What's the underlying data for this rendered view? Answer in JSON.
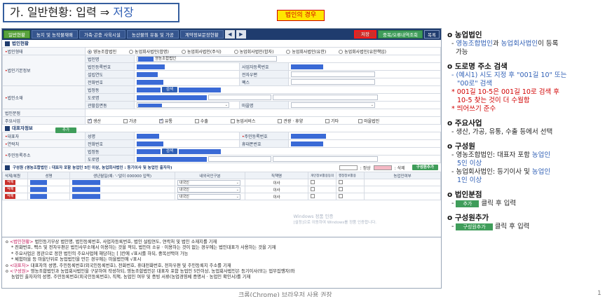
{
  "slide": {
    "title_prefix": "가. 일반현황: 입력 ⇒ ",
    "title_accent": "저장",
    "badge": "법인의 경우",
    "footer": "크롬(Chrome) 브라우저 사용 권장",
    "page_number": "1"
  },
  "tabs": [
    "일반현황",
    "농지 및 농작물재배",
    "가축·곤충 사육시설",
    "농산물의 유통 및 가공",
    "계약정보문장현황"
  ],
  "toolbar": {
    "save": "저장",
    "dup_check": "중복/오류내역조회",
    "list": "목록"
  },
  "section1": {
    "title": "법인현황",
    "corp_type_label": "법인형태",
    "corp_types": [
      "영농조합법인",
      "농업회사법인(합명)",
      "농업회사법인(주식)",
      "농업회사법인(합자)",
      "농업회사법인(유한)",
      "농업회사법인(유한책임)"
    ],
    "basic_info_label": "법인기본정보",
    "corp_name_label": "법인명",
    "corp_name_value": "영농조합법인",
    "corp_regno_label": "법인등록번호",
    "biz_regno_label": "사업자등록번호",
    "est_year_label": "설립연도",
    "email_label": "전자우편",
    "phone_label": "전화번호",
    "fax_label": "팩스",
    "location_label": "법인소재",
    "lot_label": "법정동",
    "search_btn": "검색",
    "road_label": "도로명",
    "admin_label": "관할읍면동",
    "village_label": "마을명",
    "branch_label": "법인분점",
    "add_btn": "추가",
    "main_biz_label": "주요사업",
    "main_biz": [
      {
        "label": "생산",
        "checked": true
      },
      {
        "label": "가공",
        "checked": false
      },
      {
        "label": "유통",
        "checked": true
      },
      {
        "label": "수출",
        "checked": false
      },
      {
        "label": "농업서비스",
        "checked": false
      },
      {
        "label": "관광 · 휴양",
        "checked": false
      },
      {
        "label": "기타",
        "checked": false
      },
      {
        "label": "마을법인",
        "checked": false
      }
    ]
  },
  "section2": {
    "title": "대표자정보",
    "rep_label": "대표자",
    "name_label": "성명",
    "rrn_label": "주민등록번호",
    "contact_label": "연락처",
    "phone_label": "전화번호",
    "mobile_label": "휴대폰번호",
    "address_label": "주민등록주소",
    "lot_label": "법정동",
    "search_btn": "검색",
    "road_label": "도로명"
  },
  "members": {
    "title": "구성원 (영농조합법인 : 대표자 포함 농업인 5인 이상, 농업회사법인 : 등기이사 및 농업인 출자자)",
    "legend_normal": ": 정상",
    "legend_delete": ": 삭제",
    "add_btn": "구성원추가",
    "headers": [
      "삭제/복원",
      "성명",
      "생년월일(예: '-'없이 000000 입력)",
      "내외국인구분",
      "직책명",
      "개인정보활용동의",
      "행정정보활용",
      "농업인여부"
    ],
    "rows": [
      {
        "delete": "삭제",
        "nationality": "내국인",
        "title": "이사"
      },
      {
        "delete": "삭제",
        "nationality": "내국인",
        "title": "이사"
      },
      {
        "delete": "삭제",
        "nationality": "내국인",
        "title": "이사"
      }
    ]
  },
  "watermark": [
    "Windows 정품 인증",
    "[설정]으로 이동하여 Windows를 정품 인증합니다."
  ],
  "notes": [
    {
      "bullet": "o ",
      "hl": "<법인현황>",
      "text": " 법인등기부상 법인명, 법인등록번호, 사업자등록번호, 법인 설립연도, 연락처 및 법인 소재지를 기재"
    },
    {
      "bullet": "* ",
      "hl": "",
      "text": "전화번호, 팩스 및 전자우편은 법인사무소에서 이용하는 것을 적되, 법인이 소유 · 이용하는 것이 없는 경우에는 법인대표가 사용하는 것을 기재"
    },
    {
      "bullet": "* ",
      "hl": "",
      "text": "주요사업은 정관으로 정한 법인의 주요사업에 해당하는 [ ]칸에 √표시를 하되, 중복선택이 가능"
    },
    {
      "bullet": "* ",
      "hl": "",
      "text": "체험마을 등 마을단위로 농업법인을 만든 경우에는 마을법인에 √표시"
    },
    {
      "bullet": "o ",
      "hl": "<대표자>",
      "text": " 대표자의 성명, 주민등록번호(외국인등록번호), 전화번호, 휴대전화번호, 전자우편 및 주민등록지 주소를 기재"
    },
    {
      "bullet": "o ",
      "hl": "<구성원>",
      "text": " 영농조합법인과 농업회사법인을 구분하여 작성하되, 영농조합법인은 대표자 포함 농업인 5인이상, 농업회사법인은 등기이사(또는 업무집행자)와"
    },
    {
      "bullet": "",
      "hl": "",
      "text": "농업인 출자자의 성명, 주민등록번호(외국인등록번호), 직책, 농업인 여부 및 증빙 서류(농업경영체 증명서 · 농업인 확인서)를 기재"
    }
  ],
  "panel": {
    "s1_head": "o 농업법인",
    "s1_a": "영농조합법인",
    "s1_mid": "과 ",
    "s1_b": "농업회사법인",
    "s1_tail": "이 등록",
    "s1_tail2": "가능",
    "s2_head": "o 도로명 주소 검색",
    "s2_l1": "- (예시1) 시도 지정 후 \"001길 10\" 또는",
    "s2_l2": "\"00로\" 검색",
    "s2_l3": "* 001길 10-5은 001길 10로 검색 후",
    "s2_l4": "10-5 찾는 것이 더 수월함",
    "s2_l5": "* 띄어쓰기 준수",
    "s3_head": "o 주요사업",
    "s3_l1": "- 생산, 가공, 유통, 수출 등에서 선택",
    "s4_head": "o 구성원",
    "s4_l1a": "- 영농조합법인: 대표자 포함 ",
    "s4_l1b": "농업인",
    "s4_l2": "5인 이상",
    "s4_l3a": "- 농업회사법인: 등기이사 및 ",
    "s4_l3b": "농업인",
    "s4_l4": "1인 이상",
    "s5_head": "o 법인분점",
    "s5_btn": "추가",
    "s5_text": "클릭 후 입력",
    "s6_head": "o 구성원추가",
    "s6_btn": "구성원추가",
    "s6_text": "클릭 후 입력"
  },
  "colors": {
    "navy": "#1f3c6e",
    "green": "#3f9d5a",
    "red": "#d10000",
    "accent_blue": "#2f5fb5",
    "highlight": "#ffe600"
  }
}
